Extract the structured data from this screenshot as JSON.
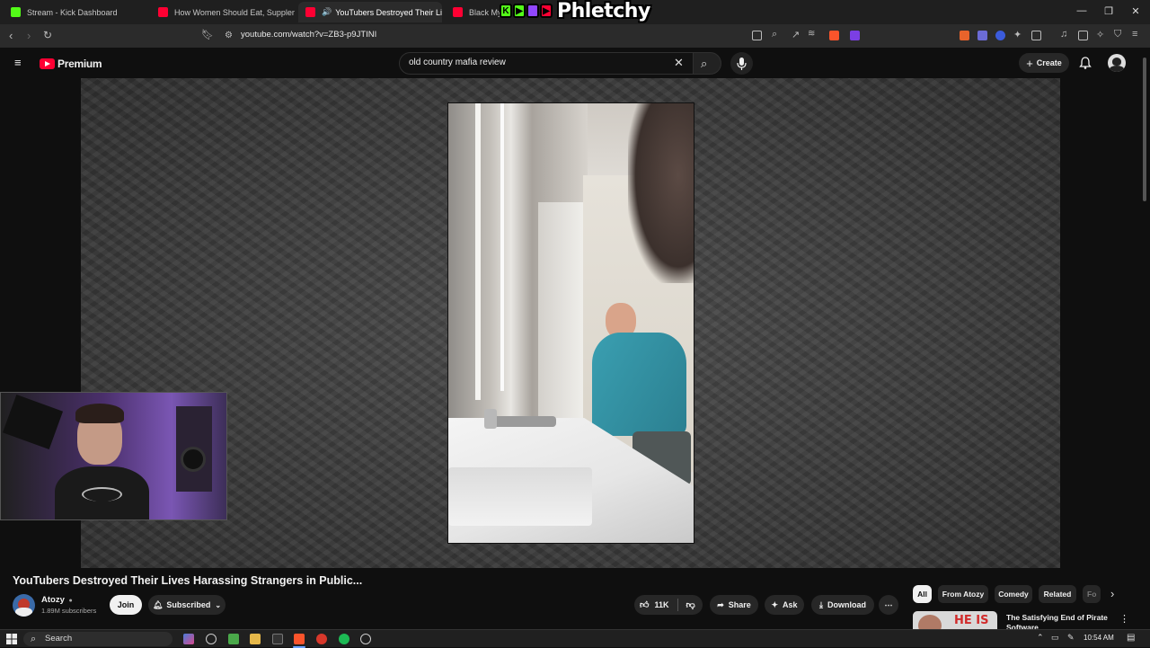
{
  "browser": {
    "tabs": [
      {
        "label": "Stream - Kick Dashboard",
        "favicon_color": "#53fc18"
      },
      {
        "label": "How Women Should Eat, Supplemen",
        "favicon_color": "#ff0033"
      },
      {
        "label": "YouTubers Destroyed Their Li",
        "favicon_color": "#ff0033",
        "active": true
      },
      {
        "label": "Black Myth",
        "favicon_color": "#ff0033"
      }
    ],
    "url": "youtube.com/watch?v=ZB3-p9JTINI",
    "overlay_logo_text": "Phletchy"
  },
  "youtube": {
    "brand": "Premium",
    "search": {
      "value": "old country mafia review"
    },
    "create_label": "Create"
  },
  "video": {
    "title": "YouTubers Destroyed Their Lives Harassing Strangers in Public...",
    "channel": "Atozy",
    "subscribers": "1.89M subscribers",
    "join_label": "Join",
    "subscribed_label": "Subscribed",
    "likes": "11K",
    "share_label": "Share",
    "ask_label": "Ask",
    "download_label": "Download"
  },
  "chips": [
    {
      "label": "All",
      "active": true
    },
    {
      "label": "From Atozy"
    },
    {
      "label": "Comedy"
    },
    {
      "label": "Related"
    },
    {
      "label": "Fo"
    }
  ],
  "recommended": {
    "title_line1": "The Satisfying End of Pirate",
    "title_line2": "Software",
    "thumb_text": "HE IS"
  },
  "taskbar": {
    "search_label": "Search",
    "clock": "10:54 AM"
  }
}
